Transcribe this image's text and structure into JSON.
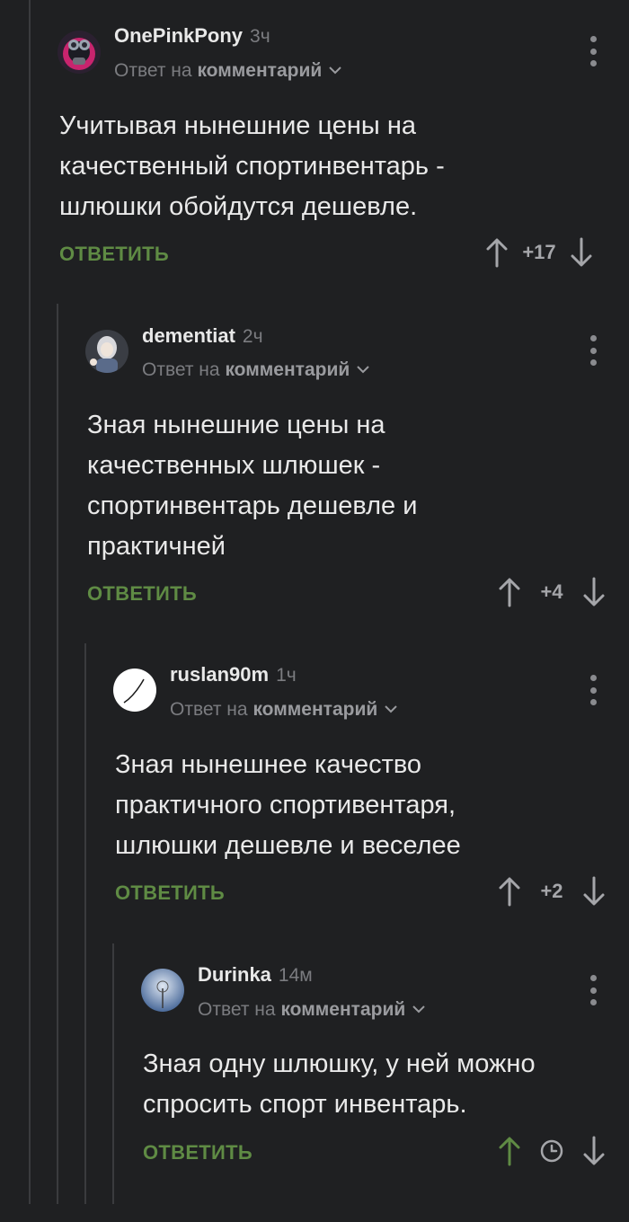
{
  "reply_label": "ОТВЕТИТЬ",
  "reply_prefix": "Ответ на",
  "reply_target": "комментарий",
  "colors": {
    "background": "#1f2022",
    "accent_green": "#5f8b44",
    "muted": "#7b7c80",
    "thread_line": "#3a3b3e"
  },
  "comments": [
    {
      "author": "OnePinkPony",
      "time": "3ч",
      "text": "Учитывая нынешние цены на\nкачественный спортинвентарь -\nшлюшки обойдутся дешевле.",
      "score": "+17"
    },
    {
      "author": "dementiat",
      "time": "2ч",
      "text": "Зная нынешние цены на\nкачественных шлюшек -\nспортинвентарь дешевле и\nпрактичней",
      "score": "+4"
    },
    {
      "author": "ruslan90m",
      "time": "1ч",
      "text": "Зная нынешнее качество\nпрактичного спортивентаря,\nшлюшки дешевле и веселее",
      "score": "+2"
    },
    {
      "author": "Durinka",
      "time": "14м",
      "text": "Зная одну шлюшку, у ней можно\nспросить спорт инвентарь.",
      "score": "",
      "score_icon": "clock-icon",
      "upvoted": true
    }
  ]
}
